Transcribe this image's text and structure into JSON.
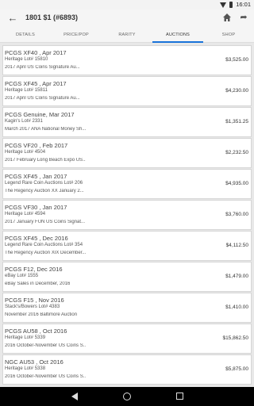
{
  "status_bar": {
    "time": "16:01"
  },
  "header": {
    "title": "1801 $1 (#6893)"
  },
  "tabs": [
    {
      "label": "DETAILS",
      "active": false
    },
    {
      "label": "PRICE/POP",
      "active": false
    },
    {
      "label": "RARITY",
      "active": false
    },
    {
      "label": "AUCTIONS",
      "active": true
    },
    {
      "label": "SHOP",
      "active": false
    }
  ],
  "auctions": [
    {
      "grade_date": "PCGS XF40 , Apr 2017",
      "lot": "Heritage Lot# 15810",
      "sale": "2017 April US Coins Signature Au...",
      "price": "$3,525.00"
    },
    {
      "grade_date": "PCGS XF45 , Apr 2017",
      "lot": "Heritage Lot# 15811",
      "sale": "2017 April US Coins Signature Au...",
      "price": "$4,230.00"
    },
    {
      "grade_date": "PCGS Genuine, Mar 2017",
      "lot": "Kagin's Lot# 2331",
      "sale": "March 2017 ANA National Money Sh...",
      "price": "$1,351.25"
    },
    {
      "grade_date": "PCGS VF20 , Feb 2017",
      "lot": "Heritage Lot# 4504",
      "sale": "2017 February Long Beach Expo US...",
      "price": "$2,232.50"
    },
    {
      "grade_date": "PCGS XF45 , Jan 2017",
      "lot": "Legend Rare Coin Auctions Lot# 206",
      "sale": "The Regency Auction XX January 2...",
      "price": "$4,935.00"
    },
    {
      "grade_date": "PCGS VF30 , Jan 2017",
      "lot": "Heritage Lot# 4594",
      "sale": "2017 January FUN US Coins Signat...",
      "price": "$3,760.00"
    },
    {
      "grade_date": "PCGS XF45 , Dec 2016",
      "lot": "Legend Rare Coin Auctions Lot# 354",
      "sale": "The Regency Auction XIX December...",
      "price": "$4,112.50"
    },
    {
      "grade_date": "PCGS F12, Dec 2016",
      "lot": "eBay Lot# 1555",
      "sale": "eBay Sales in December, 2016",
      "price": "$1,479.00"
    },
    {
      "grade_date": "PCGS F15 , Nov 2016",
      "lot": "Stack's/Bowers Lot# 4383",
      "sale": "November 2016 Baltimore Auction",
      "price": "$1,410.00"
    },
    {
      "grade_date": "PCGS AU58 , Oct 2016",
      "lot": "Heritage Lot# 5339",
      "sale": "2016 October-November US Coins S...",
      "price": "$15,862.50"
    },
    {
      "grade_date": "NGC AU53 , Oct 2016",
      "lot": "Heritage Lot# 5338",
      "sale": "2016 October-November US Coins S...",
      "price": "$5,875.00"
    }
  ],
  "icons": {
    "back": "arrow-left-icon",
    "home": "home-icon",
    "share": "share-icon",
    "wifi": "wifi-icon",
    "battery": "battery-icon",
    "nav_back": "nav-back-icon",
    "nav_home": "nav-home-icon",
    "nav_recent": "nav-recent-icon"
  },
  "colors": {
    "accent": "#1a73d9",
    "background": "#e8e8e8",
    "card": "#ffffff"
  }
}
